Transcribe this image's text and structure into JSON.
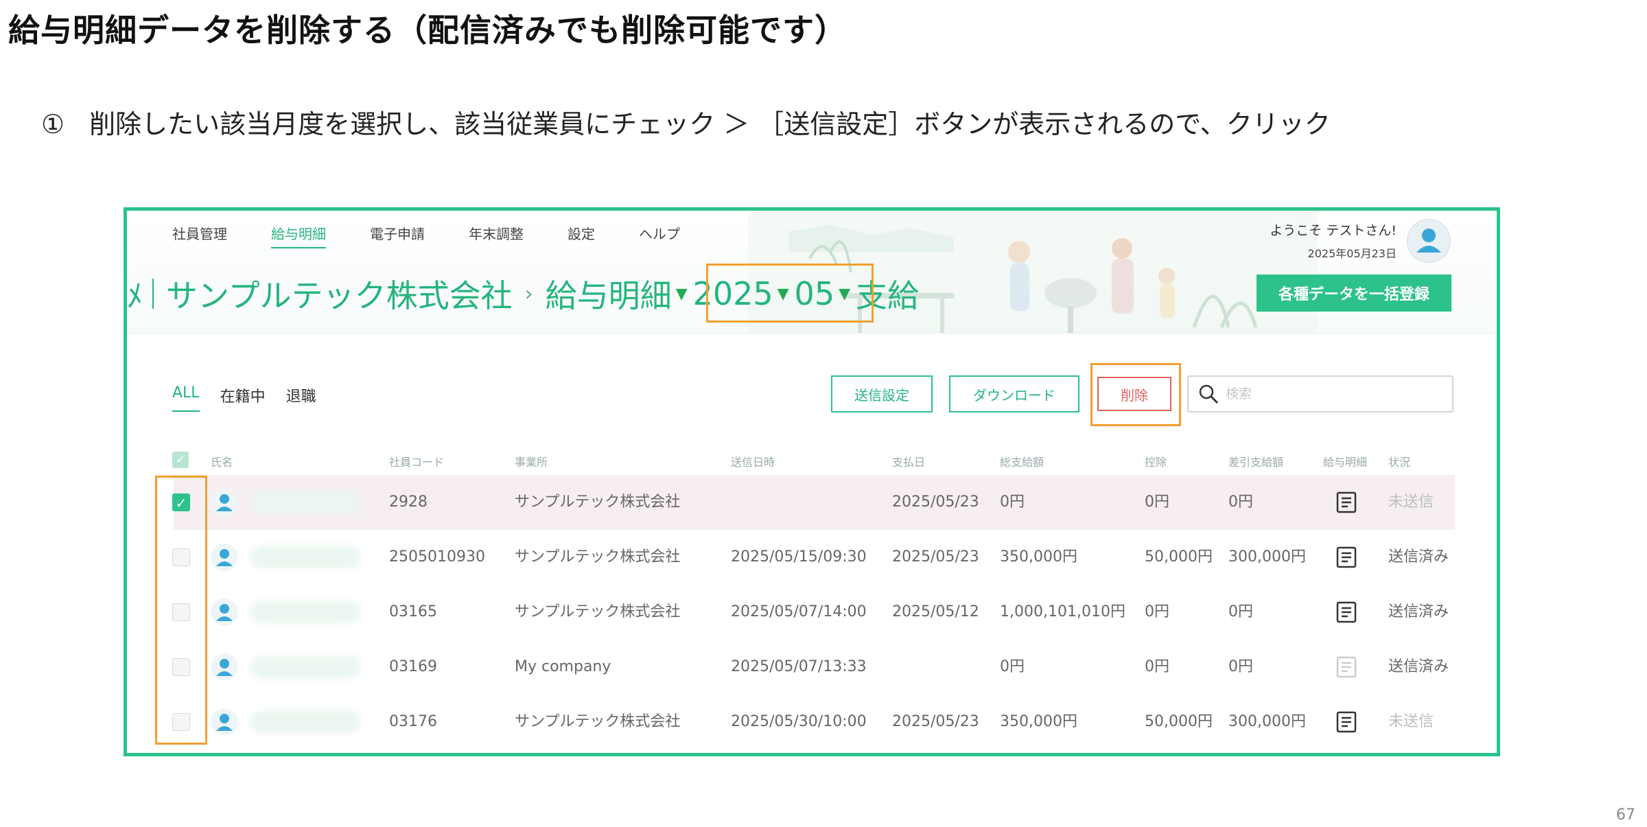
{
  "slide": {
    "title": "給与明細データを削除する（配信済みでも削除可能です）",
    "instruction_number": "①",
    "instruction": "削除したい該当月度を選択し、該当従業員にチェック ＞ ［送信設定］ボタンが表示されるので、クリック",
    "page_number": "67"
  },
  "app": {
    "nav": [
      "社員管理",
      "給与明細",
      "電子申請",
      "年末調整",
      "設定",
      "ヘルプ"
    ],
    "nav_active_index": 1,
    "welcome": "ようこそ テストさん!",
    "date": "2025年05月23日",
    "bulk_button": "各種データを一括登録",
    "breadcrumb": {
      "logo_fragment": "ﾒ",
      "company": "サンプルテック株式会社",
      "section": "給与明細",
      "year": "2025",
      "month": "05",
      "type": "支給"
    },
    "filters": [
      "ALL",
      "在籍中",
      "退職"
    ],
    "active_filter_index": 0,
    "buttons": {
      "send_settings": "送信設定",
      "download": "ダウンロード",
      "delete": "削除"
    },
    "search_placeholder": "検索",
    "columns": [
      "氏名",
      "社員コード",
      "事業所",
      "送信日時",
      "支払日",
      "総支給額",
      "控除",
      "差引支給額",
      "給与明細",
      "状況"
    ],
    "rows": [
      {
        "checked": true,
        "code": "2928",
        "office": "サンプルテック株式会社",
        "sent": "",
        "paid": "2025/05/23",
        "gross": "0円",
        "deduct": "0円",
        "net": "0円",
        "doc_dim": false,
        "status": "未送信"
      },
      {
        "checked": false,
        "code": "2505010930",
        "office": "サンプルテック株式会社",
        "sent": "2025/05/15/09:30",
        "paid": "2025/05/23",
        "gross": "350,000円",
        "deduct": "50,000円",
        "net": "300,000円",
        "doc_dim": false,
        "status": "送信済み"
      },
      {
        "checked": false,
        "code": "03165",
        "office": "サンプルテック株式会社",
        "sent": "2025/05/07/14:00",
        "paid": "2025/05/12",
        "gross": "1,000,101,010円",
        "deduct": "0円",
        "net": "0円",
        "doc_dim": false,
        "status": "送信済み"
      },
      {
        "checked": false,
        "code": "03169",
        "office": "My company",
        "sent": "2025/05/07/13:33",
        "paid": "",
        "gross": "0円",
        "deduct": "0円",
        "net": "0円",
        "doc_dim": true,
        "status": "送信済み"
      },
      {
        "checked": false,
        "code": "03176",
        "office": "サンプルテック株式会社",
        "sent": "2025/05/30/10:00",
        "paid": "2025/05/23",
        "gross": "350,000円",
        "deduct": "50,000円",
        "net": "300,000円",
        "doc_dim": false,
        "status": "未送信"
      }
    ],
    "colors": {
      "accent": "#2cc28a",
      "highlight": "#f0a030",
      "delete": "#e06060"
    }
  }
}
